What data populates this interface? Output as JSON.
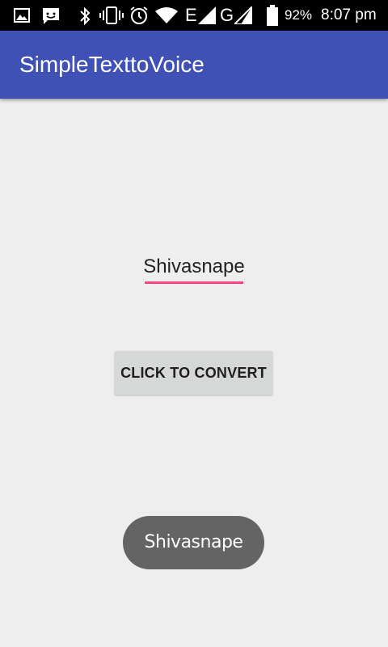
{
  "status_bar": {
    "battery_percent": "92%",
    "time": "8:07 pm",
    "network_e": "E",
    "network_g": "G",
    "icons": [
      "image-icon",
      "message-icon",
      "bluetooth-icon",
      "vibrate-icon",
      "alarm-icon",
      "wifi-icon",
      "signal-icon",
      "signal-icon",
      "battery-icon"
    ]
  },
  "app_bar": {
    "title": "SimpleTexttoVoice",
    "color": "#3f51b5"
  },
  "main": {
    "input_value": "Shivasnape",
    "underline_color": "#ff4081",
    "button_label": "CLICK TO CONVERT"
  },
  "toast": {
    "message": "Shivasnape"
  }
}
